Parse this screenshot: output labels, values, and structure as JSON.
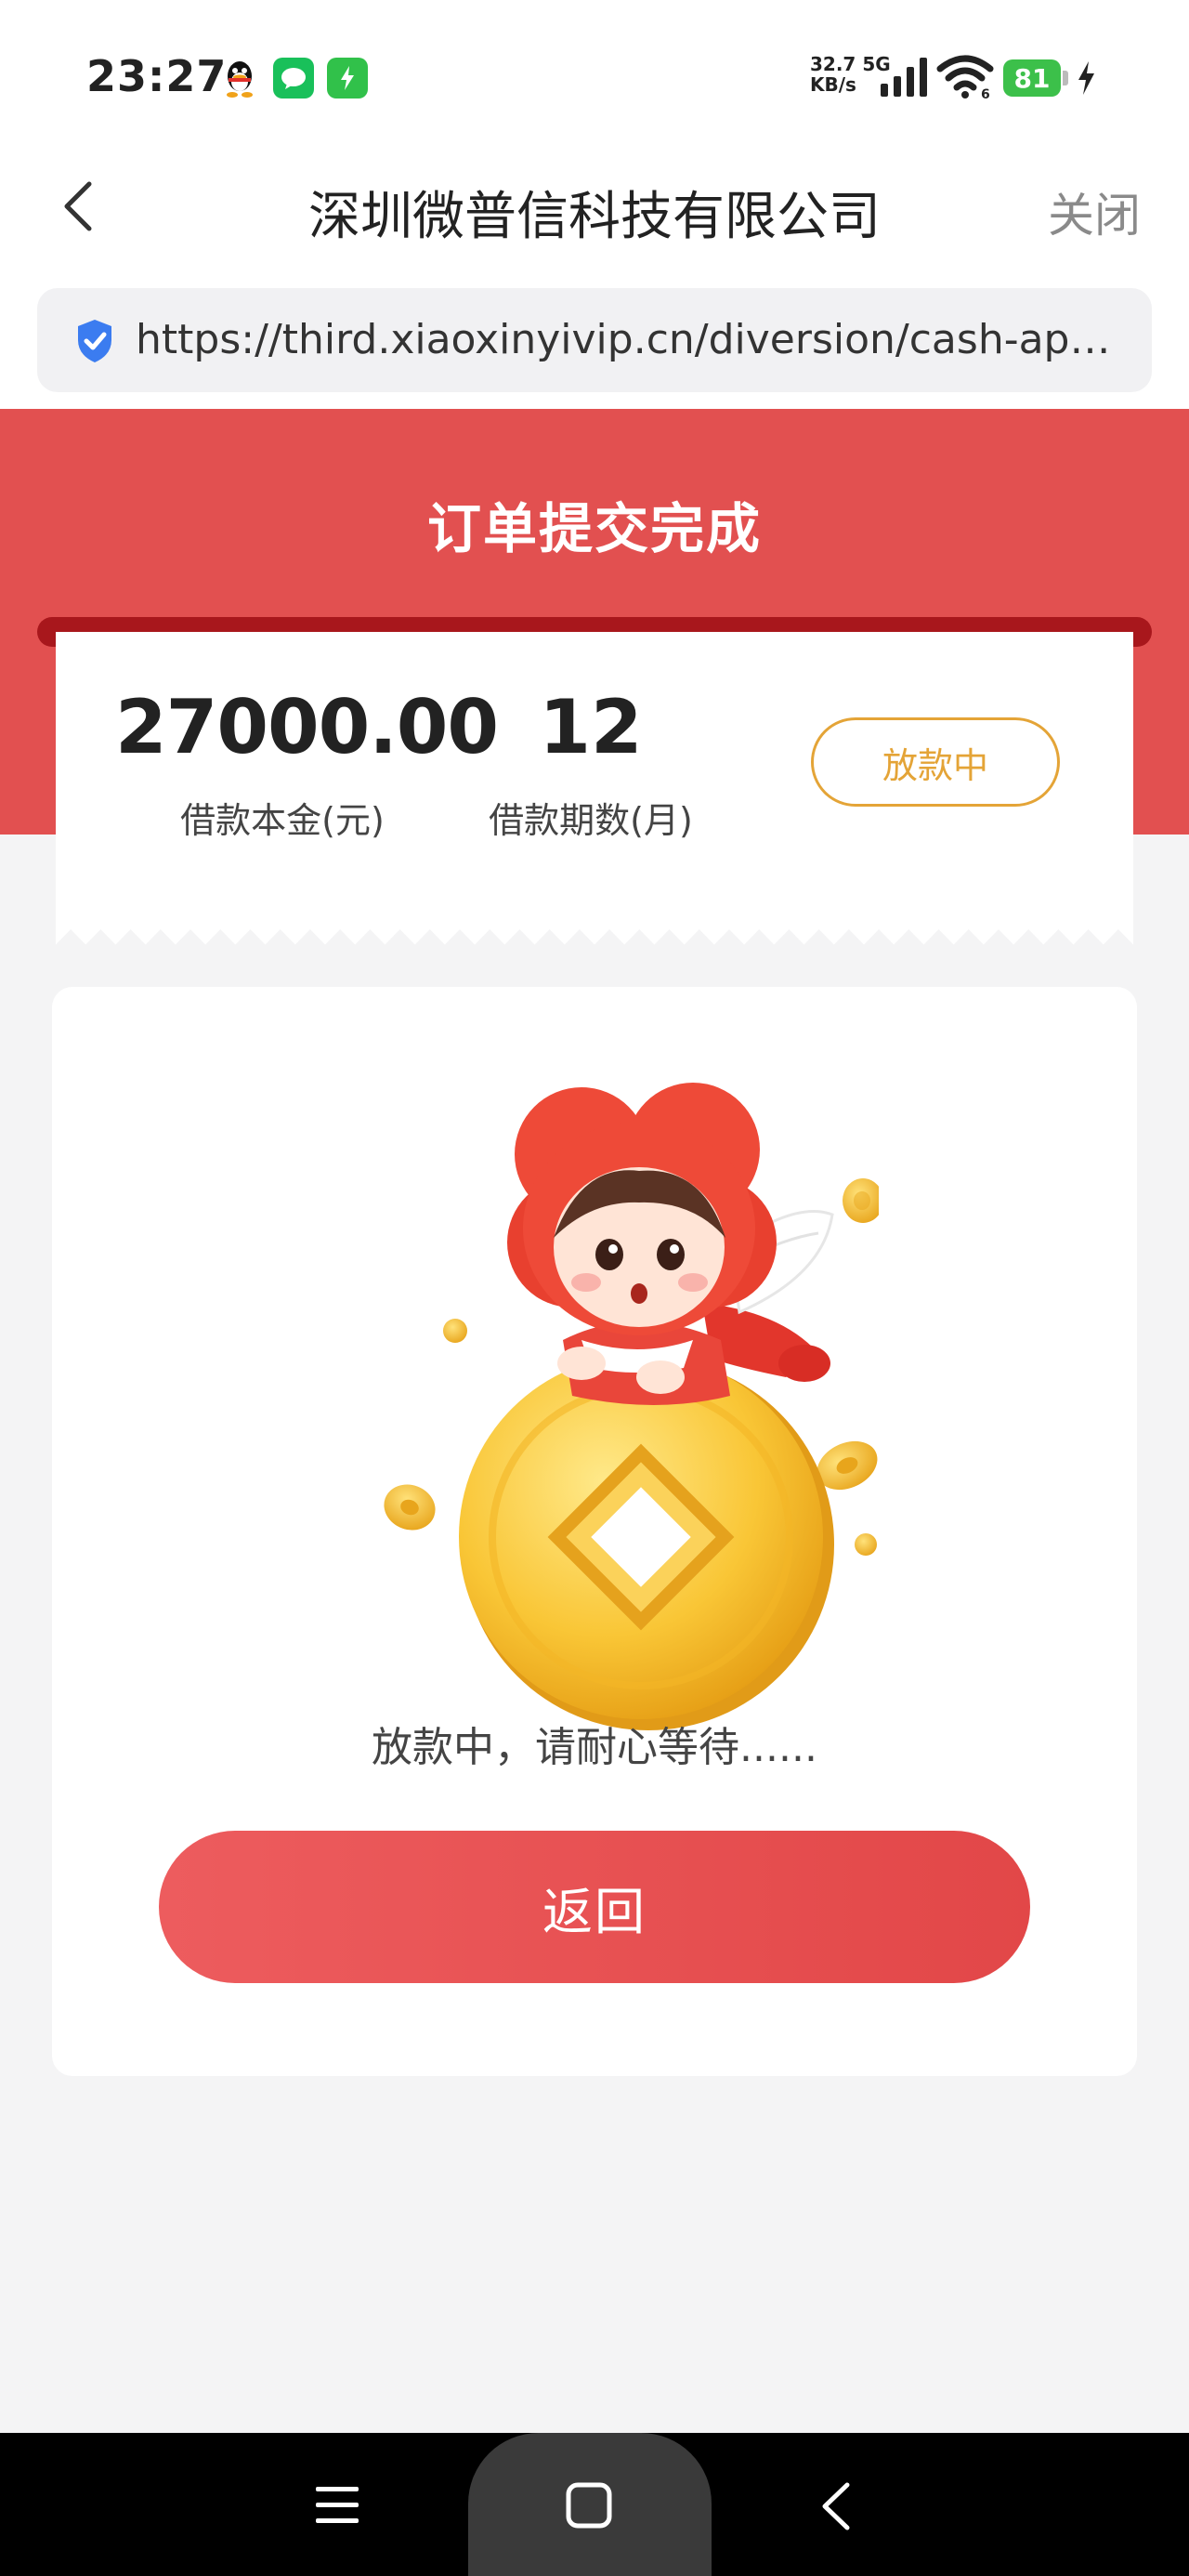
{
  "status_bar": {
    "time": "23:27",
    "net_speed": "32.7",
    "net_unit": "KB/s",
    "net_type": "5G",
    "battery": "81",
    "icons": [
      "qq-icon",
      "message-icon",
      "charging-app-icon",
      "signal-icon",
      "wifi-icon",
      "battery-icon",
      "charging-bolt-icon"
    ]
  },
  "nav": {
    "title": "深圳微普信科技有限公司",
    "close": "关闭"
  },
  "url_bar": {
    "url": "https://third.xiaoxinyivip.cn/diversion/cash-appl…"
  },
  "header": {
    "title": "订单提交完成"
  },
  "summary": {
    "amount": "27000.00",
    "amount_label": "借款本金(元)",
    "term": "12",
    "term_label": "借款期数(月)",
    "status": "放款中"
  },
  "main": {
    "waiting_text": "放款中，请耐心等待......",
    "return_button": "返回"
  },
  "colors": {
    "brand_red": "#e25050",
    "slot_dark_red": "#a8171c",
    "status_orange": "#e4a437",
    "button_red": "#e24748"
  }
}
